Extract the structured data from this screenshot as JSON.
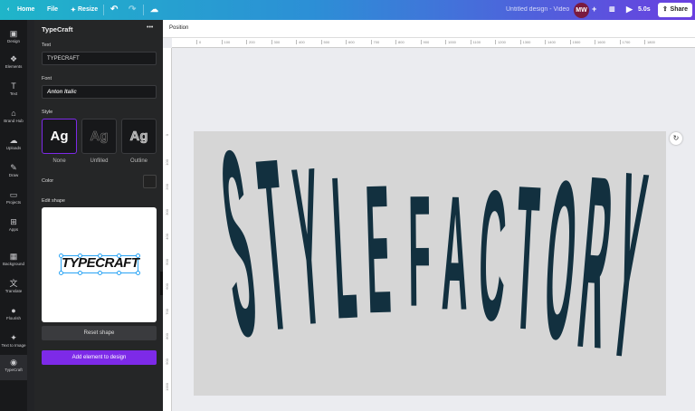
{
  "topbar": {
    "home": "Home",
    "file": "File",
    "resize": "Resize",
    "design_title": "Untitled design - Video",
    "avatar": "MW",
    "add": "+",
    "duration": "5.0s",
    "share": "Share"
  },
  "rail": [
    {
      "label": "Design",
      "icon": "▣"
    },
    {
      "label": "Elements",
      "icon": "❖"
    },
    {
      "label": "Text",
      "icon": "T"
    },
    {
      "label": "Brand Hub",
      "icon": "⌂"
    },
    {
      "label": "Uploads",
      "icon": "☁"
    },
    {
      "label": "Draw",
      "icon": "✎"
    },
    {
      "label": "Projects",
      "icon": "▭"
    },
    {
      "label": "Apps",
      "icon": "⊞"
    },
    {
      "label": "Background",
      "icon": "▦"
    },
    {
      "label": "Translate",
      "icon": "文"
    },
    {
      "label": "Flourish",
      "icon": "●"
    },
    {
      "label": "Text to Image",
      "icon": "✦"
    },
    {
      "label": "TypeCraft",
      "icon": "◉"
    }
  ],
  "panel": {
    "title": "TypeCraft",
    "more": "•••",
    "text_label": "Text",
    "text_value": "TYPECRAFT",
    "font_label": "Font",
    "font_value": "Anton Italic",
    "style_label": "Style",
    "styles": [
      {
        "glyph": "Ag",
        "label": "None"
      },
      {
        "glyph": "Ag",
        "label": "Unfilled"
      },
      {
        "glyph": "Ag",
        "label": "Outline"
      }
    ],
    "color_label": "Color",
    "edit_shape_label": "Edit shape",
    "preview_text": "TYPECRAFT",
    "reset": "Reset shape",
    "add": "Add element to design"
  },
  "toolbar": {
    "position": "Position"
  },
  "ruler_h": [
    "0",
    "100",
    "200",
    "300",
    "400",
    "500",
    "600",
    "700",
    "800",
    "900",
    "1000",
    "1100",
    "1200",
    "1300",
    "1400",
    "1500",
    "1600",
    "1700",
    "1800"
  ],
  "ruler_v": [
    "0",
    "100",
    "200",
    "300",
    "400",
    "500",
    "600",
    "700",
    "800",
    "900",
    "1000"
  ],
  "canvas": {
    "text": "STYLE FACTORY",
    "color": "#12303f"
  },
  "colors": {
    "accent": "#7d2ae8"
  }
}
